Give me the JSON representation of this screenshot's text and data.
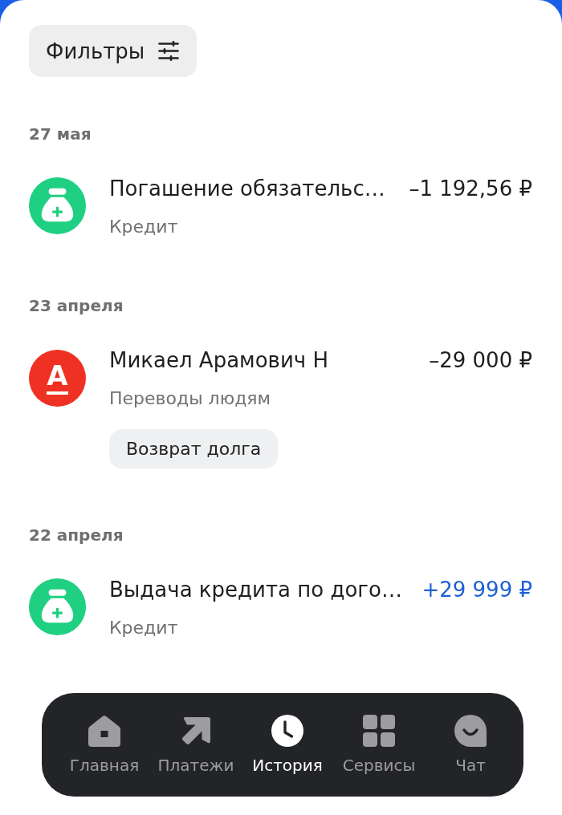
{
  "filters_button": {
    "label": "Фильтры"
  },
  "days": [
    {
      "date": "27 мая",
      "operations": [
        {
          "avatar": {
            "kind": "credit"
          },
          "title": "Погашение обязательс…",
          "category": "Кредит",
          "amount": "–1 192,56 ₽",
          "kind": "outgoing"
        }
      ]
    },
    {
      "date": "23 апреля",
      "operations": [
        {
          "avatar": {
            "kind": "bank_logo",
            "letter": "А"
          },
          "title": "Микаел Арамович Н",
          "category": "Переводы людям",
          "amount": "–29 000 ₽",
          "kind": "outgoing",
          "tag": "Возврат долга"
        }
      ]
    },
    {
      "date": "22 апреля",
      "operations": [
        {
          "avatar": {
            "kind": "credit"
          },
          "title": "Выдача кредита по дого…",
          "category": "Кредит",
          "amount": "+29 999 ₽",
          "kind": "incoming"
        }
      ]
    }
  ],
  "bottom_nav": [
    {
      "label": "Главная",
      "selected": false
    },
    {
      "label": "Платежи",
      "selected": false
    },
    {
      "label": "История",
      "selected": true
    },
    {
      "label": "Сервисы",
      "selected": false
    },
    {
      "label": "Чат",
      "selected": false
    }
  ]
}
